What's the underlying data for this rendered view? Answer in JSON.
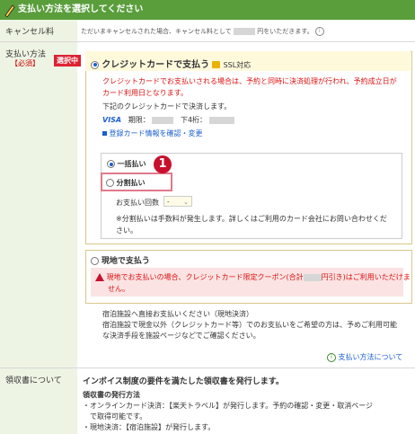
{
  "header": {
    "title": "支払い方法を選択してください"
  },
  "cancel": {
    "label": "キャンセル料",
    "text_a": "ただいまキャンセルされた場合、キャンセル料として",
    "text_b": "円をいただきます。"
  },
  "payment": {
    "label": "支払い方法",
    "required": "【必須】",
    "selected_badge": "選択中",
    "credit": {
      "title": "クレジットカードで支払う",
      "ssl": "SSL対応",
      "warning_line1": "クレジットカードでお支払いされる場合は、予約と同時に決済処理が行われ、予約成立日が",
      "warning_line2": "カード利用日となります。",
      "note": "下記のクレジットカードで決済します。",
      "brand": "VISA",
      "expiry_label": "期限：",
      "last4_label": "下4桁：",
      "edit_link": "登録カード情報を確認・変更",
      "lump_sum": "一括払い",
      "installment": "分割払い",
      "installment_count_label": "お支払い回数",
      "installment_count_value": "-",
      "installment_note_line1": "※分割払いは手数料が発生します。詳しくはご利用のカード会社にお問い合わせくだ",
      "installment_note_line2": "さい。",
      "step_number": "1"
    },
    "onsite": {
      "title": "現地で支払う",
      "warning_line1a": "現地でお支払いの場合、クレジットカード限定クーポン(合計",
      "warning_line1b": "円引き)はご利用いただけま",
      "warning_line2": "せん。",
      "info_line1": "宿泊施設へ直接お支払いください（現地決済）",
      "info_line2": "宿泊施設で現金以外（クレジットカード等）でのお支払いをご希望の方は、予めご利用可能",
      "info_line3": "な決済手段を施設ページなどでご確認ください。"
    },
    "about_link": "支払い方法について"
  },
  "receipt": {
    "label": "領収書について",
    "heading": "インボイス制度の要件を満たした領収書を発行します。",
    "subheading": "領収書の発行方法",
    "line1": "・オンラインカード決済：【楽天トラベル】が発行します。予約の確認・変更・取消ページ",
    "line2": "　で取得可能です。",
    "line3": "・現地決済：【宿泊施設】が発行します。"
  },
  "colors": {
    "header": "#5a9e3c",
    "label_bg": "#eef4e4",
    "accent_red": "#d11",
    "link_blue": "#1a5fd1"
  }
}
